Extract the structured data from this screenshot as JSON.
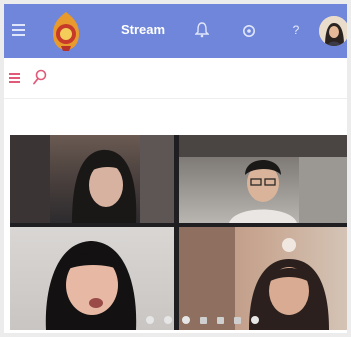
{
  "topbar": {
    "title": "Stream",
    "help_glyph": "?",
    "icons": [
      "menu-icon",
      "logo",
      "bell-icon",
      "gear-icon",
      "help-icon",
      "avatar"
    ]
  },
  "subbar": {
    "icons": [
      "menu-icon",
      "search-icon"
    ]
  },
  "video": {
    "participants": 4
  },
  "colors": {
    "topbar": "#6f86da",
    "accent": "#e15a7a"
  }
}
